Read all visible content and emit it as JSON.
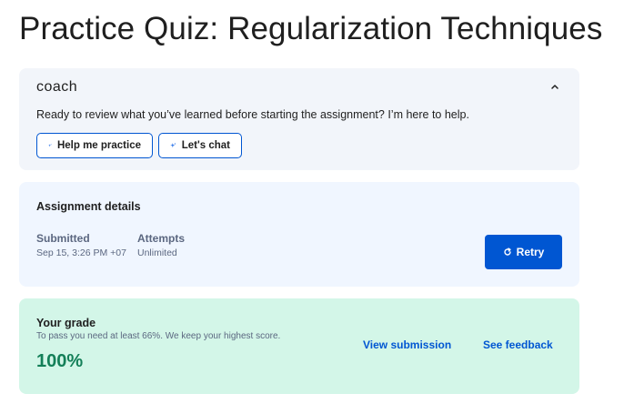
{
  "page": {
    "title": "Practice Quiz: Regularization Techniques"
  },
  "coach": {
    "brand": "coach",
    "message": "Ready to review what you’ve learned before starting the assignment? I’m here to help.",
    "practice_label": "Help me practice",
    "chat_label": "Let's chat",
    "collapse_icon": "chevron-up-icon",
    "sparkle_icon": "sparkle-icon"
  },
  "details": {
    "title": "Assignment details",
    "submitted_label": "Submitted",
    "submitted_value": "Sep 15, 3:26 PM +07",
    "attempts_label": "Attempts",
    "attempts_value": "Unlimited",
    "retry_label": "Retry",
    "retry_icon": "refresh-icon"
  },
  "grade": {
    "title": "Your grade",
    "subtitle": "To pass you need at least 66%. We keep your highest score.",
    "value": "100%",
    "view_label": "View submission",
    "feedback_label": "See feedback"
  },
  "colors": {
    "accent": "#0056d2",
    "success": "#137f58",
    "grade_bg": "#d3f6e8",
    "coach_bg": "#f2f5fa",
    "details_bg": "#f0f6ff"
  }
}
